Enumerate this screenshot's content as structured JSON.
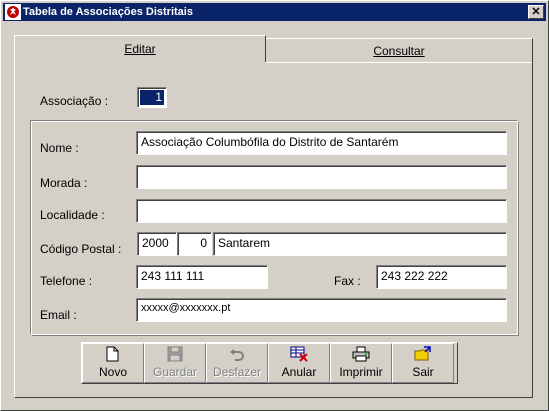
{
  "window": {
    "title": "Tabela de Associações Distritais",
    "close_glyph": "✕"
  },
  "tabs": [
    {
      "label": "Editar",
      "selected": true
    },
    {
      "label": "Consultar",
      "selected": false
    }
  ],
  "form": {
    "associacao_label": "Associação :",
    "associacao_value": "1",
    "nome_label": "Nome :",
    "nome_value": "Associação Columbófila do Distrito de Santarém",
    "morada_label": "Morada :",
    "morada_value": "",
    "localidade_label": "Localidade :",
    "localidade_value": "",
    "codigo_postal_label": "Código Postal :",
    "codigo_postal_1": "2000",
    "codigo_postal_2": "0",
    "codigo_postal_local": "Santarem",
    "telefone_label": "Telefone :",
    "telefone_value": "243 111 111",
    "fax_label": "Fax :",
    "fax_value": "243 222 222",
    "email_label": "Email :",
    "email_value": "xxxxx@xxxxxxx.pt"
  },
  "toolbar": {
    "buttons": [
      {
        "label": "Novo",
        "icon": "new-document-icon",
        "enabled": true
      },
      {
        "label": "Guardar",
        "icon": "floppy-disk-icon",
        "enabled": false
      },
      {
        "label": "Desfazer",
        "icon": "undo-icon",
        "enabled": false
      },
      {
        "label": "Anular",
        "icon": "delete-record-icon",
        "enabled": true
      },
      {
        "label": "Imprimir",
        "icon": "printer-icon",
        "enabled": true
      },
      {
        "label": "Sair",
        "icon": "exit-folder-icon",
        "enabled": true
      }
    ]
  },
  "colors": {
    "titlebar": "#0a246a",
    "face": "#d4d0c8",
    "selection": "#0a246a"
  }
}
